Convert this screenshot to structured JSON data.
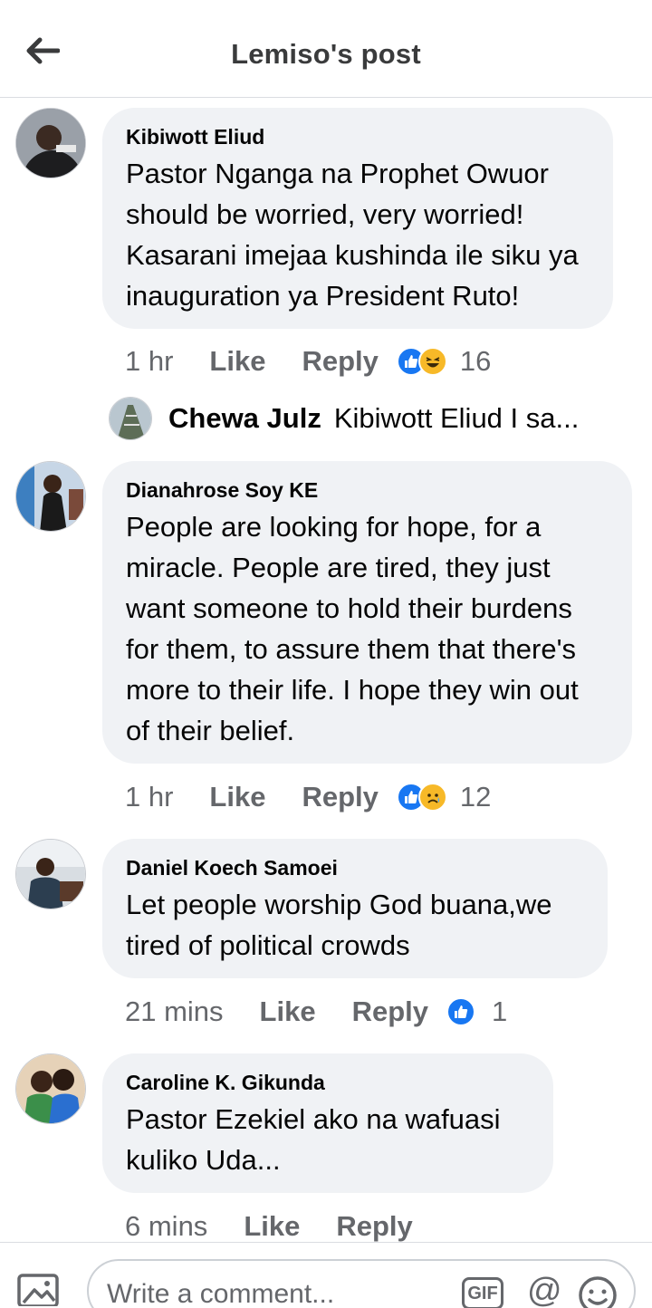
{
  "header": {
    "title": "Lemiso's post"
  },
  "comments": [
    {
      "author": "Kibiwott Eliud",
      "text": "Pastor Nganga na Prophet Owuor should be worried, very worried! Kasarani imejaa kushinda ile siku ya inauguration ya President Ruto!",
      "time": "1 hr",
      "like_label": "Like",
      "reply_label": "Reply",
      "reaction_icons": [
        "like-icon",
        "laugh-icon"
      ],
      "reaction_count": "16"
    },
    {
      "author": "Dianahrose Soy KE",
      "text": "People are looking for hope, for a miracle. People are tired, they just want someone to hold their burdens for them, to assure them that there's more to their life. I hope they win out of their belief.",
      "time": "1 hr",
      "like_label": "Like",
      "reply_label": "Reply",
      "reaction_icons": [
        "like-icon",
        "sad-icon"
      ],
      "reaction_count": "12"
    },
    {
      "author": "Daniel Koech Samoei",
      "text": "Let people worship God buana,we tired of political crowds",
      "time": "21 mins",
      "like_label": "Like",
      "reply_label": "Reply",
      "reaction_icons": [
        "like-icon"
      ],
      "reaction_count": "1"
    },
    {
      "author": "Caroline K. Gikunda",
      "text": "Pastor Ezekiel ako na wafuasi kuliko Uda...",
      "time": "6 mins",
      "like_label": "Like",
      "reply_label": "Reply"
    }
  ],
  "reply_preview": {
    "author": "Chewa Julz",
    "text": "Kibiwott Eliud I sa..."
  },
  "composer": {
    "placeholder": "Write a comment...",
    "gif_label": "GIF",
    "at_symbol": "@"
  },
  "colors": {
    "bubble": "#f0f2f5",
    "secondary_text": "#65676b",
    "like_blue": "#1877f2",
    "emoji_yellow": "#f7b928"
  }
}
